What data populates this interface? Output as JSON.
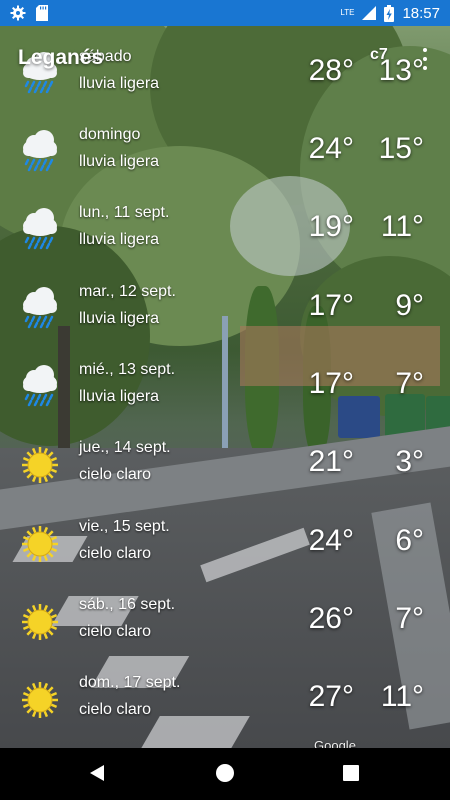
{
  "status_bar": {
    "time": "18:57",
    "network": "LTE",
    "icons": [
      "settings-icon",
      "sd-card-icon",
      "signal-icon",
      "battery-icon"
    ]
  },
  "header": {
    "city": "Leganés",
    "small_label": "c7",
    "menu_icon": "more-vert-icon"
  },
  "forecast": [
    {
      "day": "sábado",
      "condition": "lluvia ligera",
      "high": "28°",
      "low": "13°",
      "icon": "rain-cloud-icon"
    },
    {
      "day": "domingo",
      "condition": "lluvia ligera",
      "high": "24°",
      "low": "15°",
      "icon": "rain-cloud-icon"
    },
    {
      "day": "lun., 11 sept.",
      "condition": "lluvia ligera",
      "high": "19°",
      "low": "11°",
      "icon": "rain-cloud-icon"
    },
    {
      "day": "mar., 12 sept.",
      "condition": "lluvia ligera",
      "high": "17°",
      "low": "9°",
      "icon": "rain-cloud-icon"
    },
    {
      "day": "mié., 13 sept.",
      "condition": "lluvia ligera",
      "high": "17°",
      "low": "7°",
      "icon": "rain-cloud-icon"
    },
    {
      "day": "jue., 14 sept.",
      "condition": "cielo claro",
      "high": "21°",
      "low": "3°",
      "icon": "sun-icon"
    },
    {
      "day": "vie., 15 sept.",
      "condition": "cielo claro",
      "high": "24°",
      "low": "6°",
      "icon": "sun-icon"
    },
    {
      "day": "sáb., 16 sept.",
      "condition": "cielo claro",
      "high": "26°",
      "low": "7°",
      "icon": "sun-icon"
    },
    {
      "day": "dom., 17 sept.",
      "condition": "cielo claro",
      "high": "27°",
      "low": "11°",
      "icon": "sun-icon"
    }
  ],
  "attribution": "Google",
  "colors": {
    "status_bar": "#1976D2",
    "sun": "#F5D327",
    "cloud": "#F2F4F6",
    "rain": "#1E88E5"
  }
}
